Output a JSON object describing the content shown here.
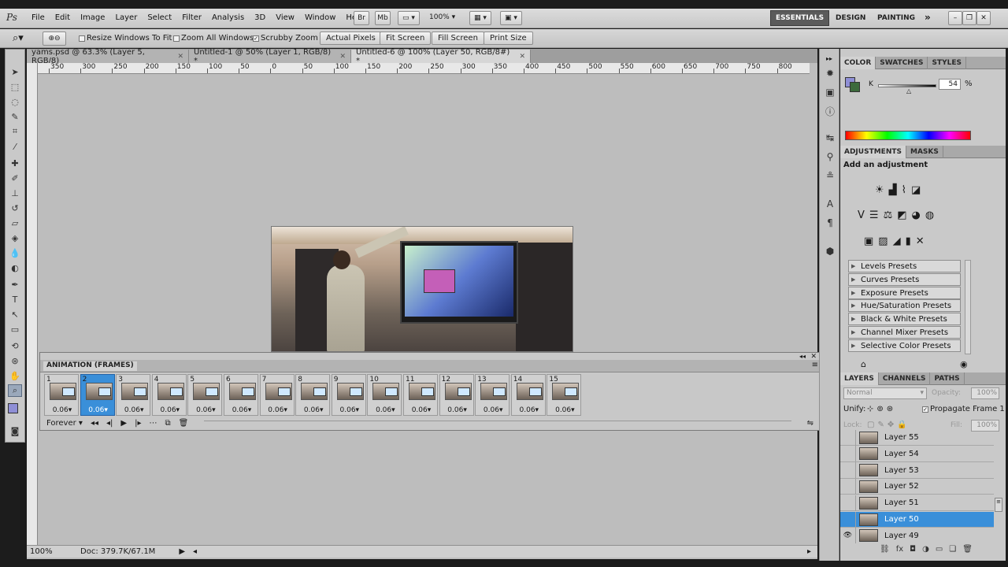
{
  "app": {
    "logo": "Ps"
  },
  "menu": [
    "File",
    "Edit",
    "Image",
    "Layer",
    "Select",
    "Filter",
    "Analysis",
    "3D",
    "View",
    "Window",
    "Help"
  ],
  "topbar": {
    "zoom_value": "100%",
    "workspaces": [
      "ESSENTIALS",
      "DESIGN",
      "PAINTING"
    ],
    "active_workspace": "ESSENTIALS",
    "more_icon": "double-chevron-right-icon"
  },
  "options": {
    "resize_windows": {
      "label": "Resize Windows To Fit",
      "checked": false
    },
    "zoom_all": {
      "label": "Zoom All Windows",
      "checked": false
    },
    "scrubby_zoom": {
      "label": "Scrubby Zoom",
      "checked": true
    },
    "buttons": [
      "Actual Pixels",
      "Fit Screen",
      "Fill Screen",
      "Print Size"
    ]
  },
  "doc_tabs": [
    {
      "title": "yams.psd @ 63.3% (Layer 5, RGB/8)",
      "active": false
    },
    {
      "title": "Untitled-1 @ 50% (Layer 1, RGB/8) *",
      "active": false
    },
    {
      "title": "Untitled-6 @ 100% (Layer 50, RGB/8#) *",
      "active": true
    }
  ],
  "ruler_labels": [
    "350",
    "300",
    "250",
    "200",
    "150",
    "100",
    "50",
    "0",
    "50",
    "100",
    "150",
    "200",
    "250",
    "300",
    "350",
    "400",
    "450",
    "500",
    "550",
    "600",
    "650",
    "700",
    "750",
    "800"
  ],
  "animation": {
    "title": "ANIMATION (FRAMES)",
    "frames": [
      {
        "num": "1",
        "delay": "0.06"
      },
      {
        "num": "2",
        "delay": "0.06",
        "selected": true
      },
      {
        "num": "3",
        "delay": "0.06"
      },
      {
        "num": "4",
        "delay": "0.06"
      },
      {
        "num": "5",
        "delay": "0.06"
      },
      {
        "num": "6",
        "delay": "0.06"
      },
      {
        "num": "7",
        "delay": "0.06"
      },
      {
        "num": "8",
        "delay": "0.06"
      },
      {
        "num": "9",
        "delay": "0.06"
      },
      {
        "num": "10",
        "delay": "0.06"
      },
      {
        "num": "11",
        "delay": "0.06"
      },
      {
        "num": "12",
        "delay": "0.06"
      },
      {
        "num": "13",
        "delay": "0.06"
      },
      {
        "num": "14",
        "delay": "0.06"
      },
      {
        "num": "15",
        "delay": "0.06"
      }
    ],
    "loop": "Forever"
  },
  "color_panel": {
    "tabs": [
      "COLOR",
      "SWATCHES",
      "STYLES"
    ],
    "channel": "K",
    "value": "54",
    "unit": "%",
    "fg_color": "#8f8fd6",
    "bg_color": "#3c6a3c"
  },
  "adjustments": {
    "tabs": [
      "ADJUSTMENTS",
      "MASKS"
    ],
    "heading": "Add an adjustment",
    "presets": [
      "Levels Presets",
      "Curves Presets",
      "Exposure Presets",
      "Hue/Saturation Presets",
      "Black & White Presets",
      "Channel Mixer Presets",
      "Selective Color Presets"
    ]
  },
  "layers": {
    "tabs": [
      "LAYERS",
      "CHANNELS",
      "PATHS"
    ],
    "blend_mode": "Normal",
    "opacity_label": "Opacity:",
    "opacity": "100%",
    "unify_label": "Unify:",
    "propagate_label": "Propagate Frame 1",
    "lock_label": "Lock:",
    "fill_label": "Fill:",
    "fill": "100%",
    "items": [
      {
        "name": "Layer 55",
        "visible": false
      },
      {
        "name": "Layer 54",
        "visible": false
      },
      {
        "name": "Layer 53",
        "visible": false
      },
      {
        "name": "Layer 52",
        "visible": false
      },
      {
        "name": "Layer 51",
        "visible": false
      },
      {
        "name": "Layer 50",
        "visible": false,
        "selected": true
      },
      {
        "name": "Layer 49",
        "visible": true
      }
    ]
  },
  "status": {
    "zoom": "100%",
    "doc": "Doc: 379.7K/67.1M"
  },
  "colors": {
    "accent": "#3a8fd9"
  }
}
